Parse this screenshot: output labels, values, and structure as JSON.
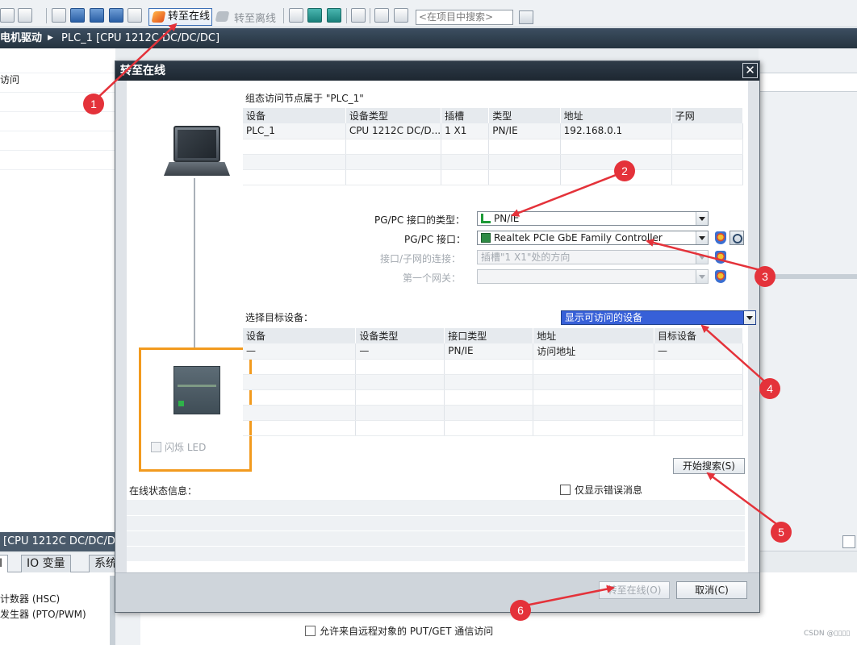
{
  "toolbar": {
    "go_online_label": "转至在线",
    "go_offline_label": "转至离线",
    "search_placeholder": "<在项目中搜索>"
  },
  "breadcrumb": {
    "part1": "电机驱动",
    "part2": "PLC_1 [CPU 1212C DC/DC/DC]"
  },
  "left_pane": {
    "item": "访问"
  },
  "dialog": {
    "title": "转至在线",
    "close_glyph": "✕",
    "config_caption": "组态访问节点属于 \"PLC_1\"",
    "config_table": {
      "headers": [
        "设备",
        "设备类型",
        "插槽",
        "类型",
        "地址",
        "子网"
      ],
      "rows": [
        [
          "PLC_1",
          "CPU 1212C DC/D...",
          "1 X1",
          "PN/IE",
          "192.168.0.1",
          ""
        ],
        [
          "",
          "",
          "",
          "",
          "",
          ""
        ],
        [
          "",
          "",
          "",
          "",
          "",
          ""
        ],
        [
          "",
          "",
          "",
          "",
          "",
          ""
        ]
      ]
    },
    "interface_type_label": "PG/PC 接口的类型：",
    "interface_type_value": "PN/IE",
    "interface_label": "PG/PC 接口：",
    "interface_value": "Realtek PCIe GbE Family Controller",
    "subnet_conn_label": "接口/子网的连接：",
    "subnet_conn_value": "插槽\"1 X1\"处的方向",
    "gateway_label": "第一个网关：",
    "gateway_value": "",
    "select_target_label": "选择目标设备：",
    "target_filter_value": "显示可访问的设备",
    "target_table": {
      "headers": [
        "设备",
        "设备类型",
        "接口类型",
        "地址",
        "目标设备"
      ],
      "rows": [
        [
          "—",
          "—",
          "PN/IE",
          "访问地址",
          "—"
        ],
        [
          "",
          "",
          "",
          "",
          ""
        ],
        [
          "",
          "",
          "",
          "",
          ""
        ],
        [
          "",
          "",
          "",
          "",
          ""
        ],
        [
          "",
          "",
          "",
          "",
          ""
        ],
        [
          "",
          "",
          "",
          "",
          ""
        ]
      ]
    },
    "flash_led_label": "闪烁 LED",
    "start_search_label": "开始搜索(S)",
    "online_status_label": "在线状态信息：",
    "only_errors_label": "仅显示错误消息",
    "go_online_button": "转至在线(O)",
    "cancel_button": "取消(C)"
  },
  "inspector": {
    "title": "[CPU 1212C DC/DC/D",
    "tabs": [
      "I",
      "IO 变量",
      "系统"
    ],
    "items": [
      "计数器 (HSC)",
      "发生器 (PTO/PWM)"
    ],
    "putget_label": "允许来自远程对象的 PUT/GET 通信访问"
  },
  "annotations": [
    "1",
    "2",
    "3",
    "4",
    "5",
    "6"
  ],
  "colors": {
    "accent": "#3760d8",
    "annotation": "#e4323a",
    "highlight_frame": "#f29a1e"
  },
  "watermark": "CSDN @▯▯▯▯"
}
